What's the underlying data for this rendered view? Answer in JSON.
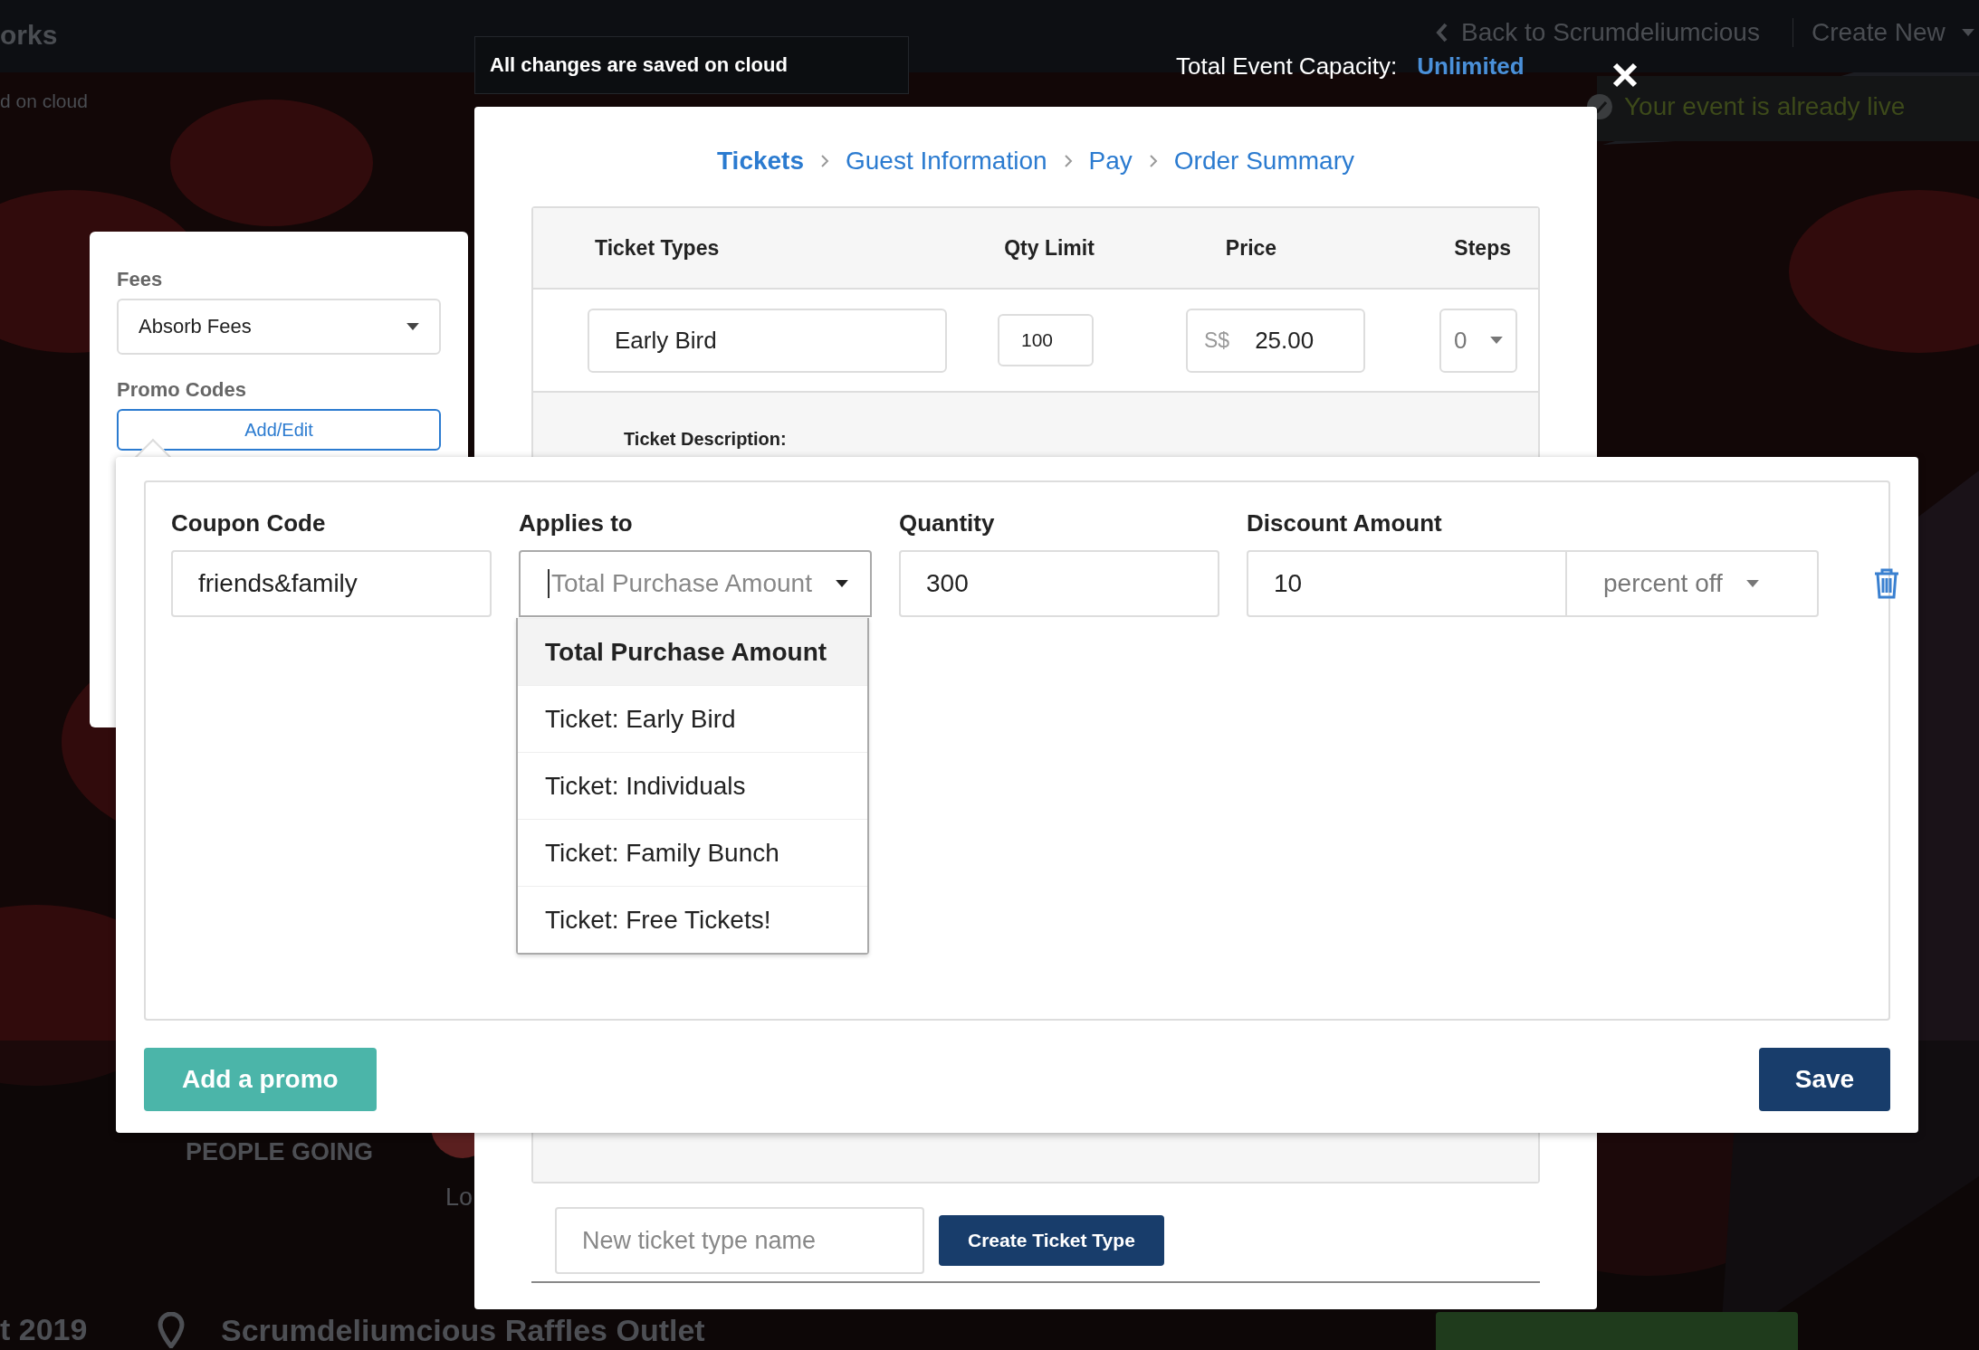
{
  "background": {
    "site_title": "orks",
    "save_status": "d on cloud",
    "back_link": "Back to Scrumdeliumcious",
    "create_menu": "Create New",
    "live_status": "Your event is already live",
    "people_going": "PEOPLE GOING",
    "attendee_name": "Lo",
    "event_date": "t 2019",
    "venue": "Scrumdeliumcious Raffles Outlet"
  },
  "header": {
    "save_notice": "All changes are saved on cloud",
    "capacity_label": "Total Event Capacity:",
    "capacity_value": "Unlimited"
  },
  "settings_panel": {
    "fees_label": "Fees",
    "fees_value": "Absorb Fees",
    "promo_label": "Promo Codes",
    "promo_button": "Add/Edit"
  },
  "ticket_editor": {
    "breadcrumbs": [
      {
        "label": "Tickets",
        "selected": true
      },
      {
        "label": "Guest Information",
        "selected": false
      },
      {
        "label": "Pay",
        "selected": false
      },
      {
        "label": "Order Summary",
        "selected": false
      }
    ],
    "columns": [
      "Ticket Types",
      "Qty Limit",
      "Price",
      "Steps"
    ],
    "rows": [
      {
        "name": "Early Bird",
        "qty_limit": "100",
        "currency": "S$",
        "price": "25.00",
        "steps": "0"
      }
    ],
    "description_label": "Ticket Description:",
    "new_type_placeholder": "New ticket type name",
    "create_button": "Create Ticket Type"
  },
  "promo_editor": {
    "columns": [
      "Coupon Code",
      "Applies to",
      "Quantity",
      "Discount Amount"
    ],
    "coupon_code": "friends&family",
    "applies_to_placeholder": "Total Purchase Amount",
    "quantity": "300",
    "discount_amount": "10",
    "discount_unit": "percent off",
    "options": [
      {
        "label": "Total Purchase Amount",
        "selected": true
      },
      {
        "label": "Ticket: Early Bird",
        "selected": false
      },
      {
        "label": "Ticket: Individuals",
        "selected": false
      },
      {
        "label": "Ticket: Family Bunch",
        "selected": false
      },
      {
        "label": "Ticket: Free Tickets!",
        "selected": false
      }
    ],
    "add_button": "Add a promo",
    "save_button": "Save"
  }
}
